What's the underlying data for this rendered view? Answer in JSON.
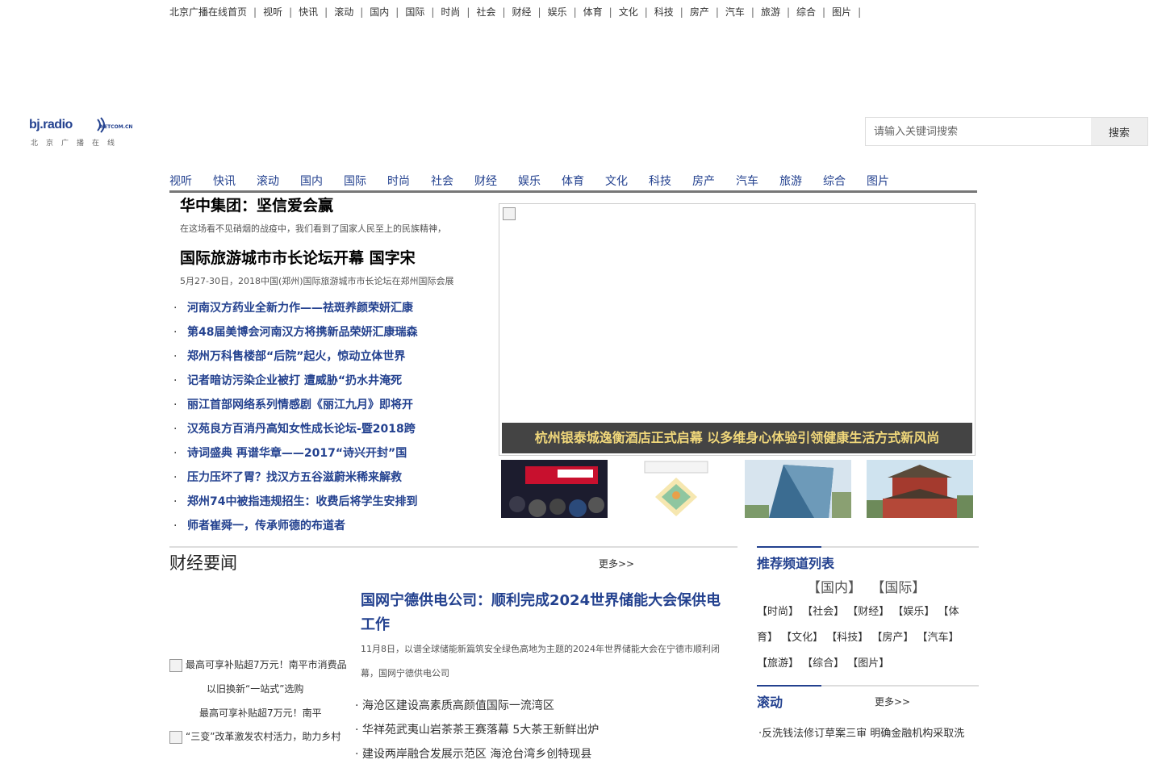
{
  "top_nav": [
    "北京广播在线首页",
    "视听",
    "快讯",
    "滚动",
    "国内",
    "国际",
    "时尚",
    "社会",
    "财经",
    "娱乐",
    "体育",
    "文化",
    "科技",
    "房产",
    "汽车",
    "旅游",
    "综合",
    "图片"
  ],
  "logo": {
    "brand": "bj.radio",
    "domain": "NETCOM.CN",
    "cn": "北京广播在线"
  },
  "search": {
    "placeholder": "请输入关键词搜索",
    "button": "搜索"
  },
  "channel_nav": [
    "视听",
    "快讯",
    "滚动",
    "国内",
    "国际",
    "时尚",
    "社会",
    "财经",
    "娱乐",
    "体育",
    "文化",
    "科技",
    "房产",
    "汽车",
    "旅游",
    "综合",
    "图片"
  ],
  "headlines": [
    {
      "title": "华中集团：坚信爱会赢",
      "desc": "在这场看不见硝烟的战疫中，我们看到了国家人民至上的民族精神，"
    },
    {
      "title": "国际旅游城市市长论坛开幕 国字宋",
      "desc": "5月27-30日，2018中国(郑州)国际旅游城市市长论坛在郑州国际会展"
    }
  ],
  "news_list": [
    "河南汉方药业全新力作——祛斑养颜荣妍汇康",
    "第48届美博会河南汉方将携新品荣妍汇康瑞森",
    "郑州万科售楼部“后院”起火，惊动立体世界",
    "记者暗访污染企业被打  遭威胁“扔水井淹死",
    "丽江首部网络系列情感剧《丽江九月》即将开",
    "汉苑良方百消丹高知女性成长论坛-暨2018跨",
    "诗词盛典  再谱华章——2017“诗兴开封”国",
    "压力压坏了胃？找汉方五谷滋蔚米稀来解救",
    "郑州74中被指违规招生：收费后将学生安排到",
    "师者崔舜一，传承师德的布道者"
  ],
  "slide": {
    "caption": "杭州银泰城逸衡酒店正式启幕  以多维身心体验引领健康生活方式新风尚"
  },
  "finance": {
    "title": "财经要闻",
    "more": "更多>>",
    "headline": "国网宁德供电公司：顺利完成2024世界储能大会保供电工作",
    "desc": "11月8日，以谱全球储能新篇筑安全绿色高地为主题的2024年世界储能大会在宁德市顺利闭幕，国网宁德供电公司",
    "pics": [
      {
        "line1": "最高可享补贴超7万元！南平市消费品",
        "line2": "以旧换新“一站式”选购",
        "line3": "最高可享补贴超7万元！南平"
      },
      {
        "line1": "“三变”改革激发农村活力，助力乡村"
      }
    ],
    "list": [
      "海沧区建设高素质高颜值国际一流湾区",
      "华祥苑武夷山岩茶茶王赛落幕  5大茶王新鲜出炉",
      "建设两岸融合发展示范区  海沧台湾乡创特现县"
    ]
  },
  "recommend": {
    "title": "推荐频道列表",
    "big": [
      "【国内】",
      "【国际】"
    ],
    "small": "【时尚】 【社会】 【财经】 【娱乐】 【体育】 【文化】 【科技】 【房产】 【汽车】 【旅游】 【综合】 【图片】"
  },
  "rolling": {
    "title": "滚动",
    "more": "更多>>",
    "items": [
      "·反洗钱法修订草案三审  明确金融机构采取洗"
    ]
  },
  "colors": {
    "link_blue": "#23418f",
    "caption_gold": "#f0d77a",
    "caption_bg": "#444444"
  }
}
